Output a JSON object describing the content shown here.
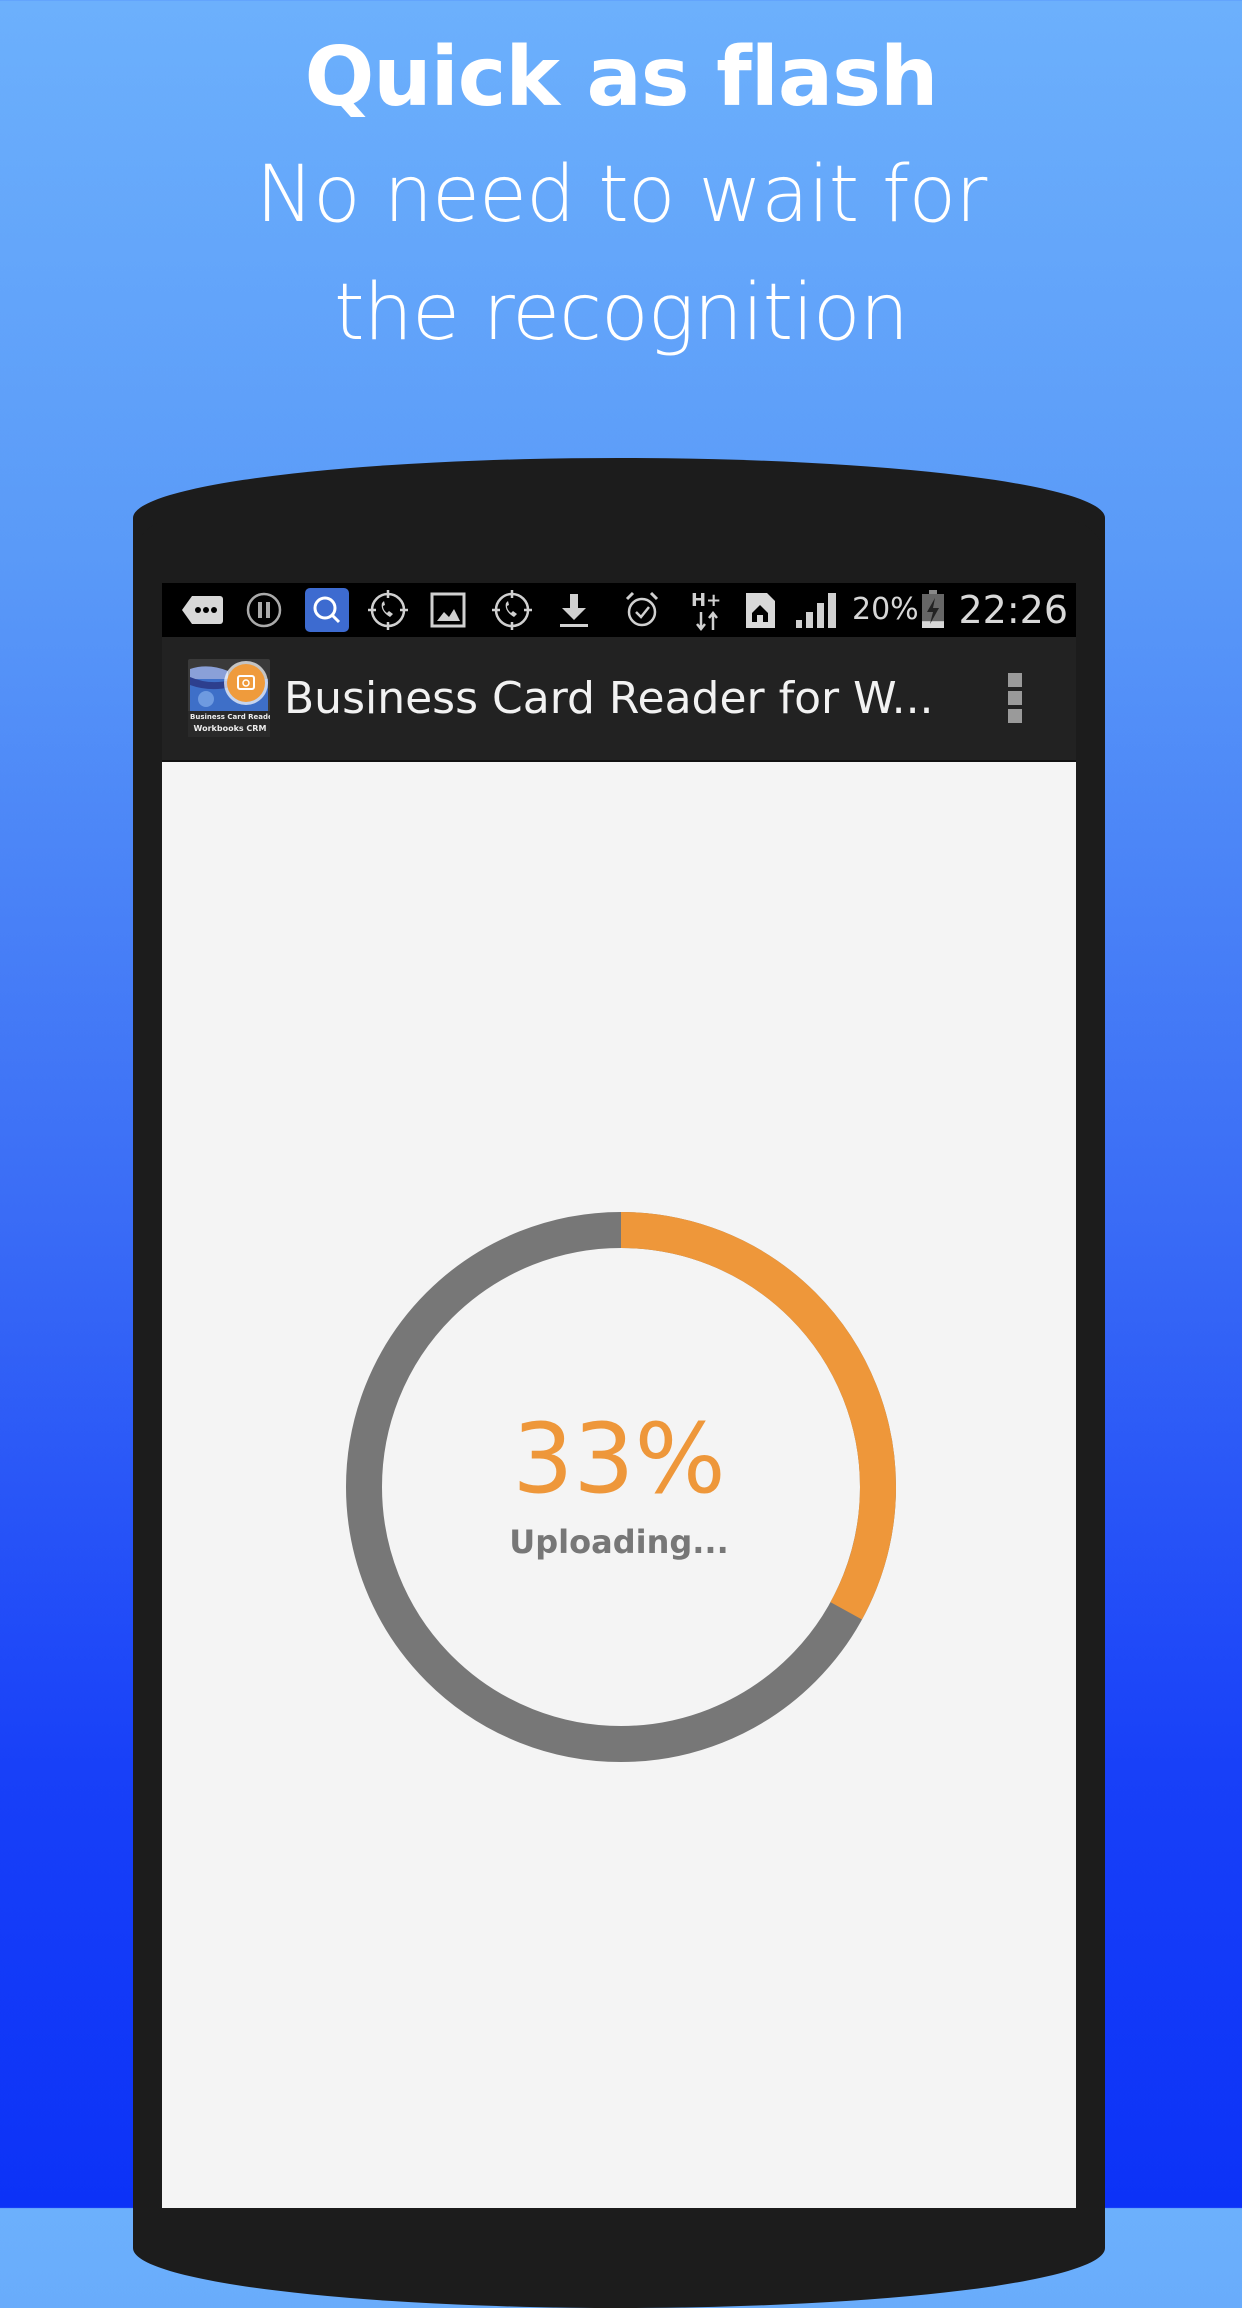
{
  "promo": {
    "headline": "Quick as flash",
    "subline_1": "No need to wait for",
    "subline_2": "the recognition"
  },
  "statusbar": {
    "icons": [
      "messages-more-icon",
      "pause-icon",
      "search-app-icon",
      "call-target-icon",
      "gallery-icon",
      "call-target-icon",
      "download-icon",
      "alarm-icon",
      "hplus-data-icon",
      "sim-home-icon",
      "signal-icon"
    ],
    "battery_percent": "20%",
    "battery_level": 0.2,
    "time": "22:26"
  },
  "appbar": {
    "app_icon_caption_1": "Business Card Reader",
    "app_icon_caption_2": "Workbooks CRM",
    "title": "Business Card Reader for W...",
    "overflow_icon": "more-vert-icon"
  },
  "progress": {
    "value": 0.33,
    "percent_label": "33%",
    "status": "Uploading...",
    "colors": {
      "progress": "#ee973a",
      "track": "#777777"
    }
  },
  "colors": {
    "bg_top": "#6cb0fc",
    "bg_bottom": "#0c32f7",
    "phone_body": "#1c1c1c",
    "search_icon_bg": "#3d6bd0"
  }
}
